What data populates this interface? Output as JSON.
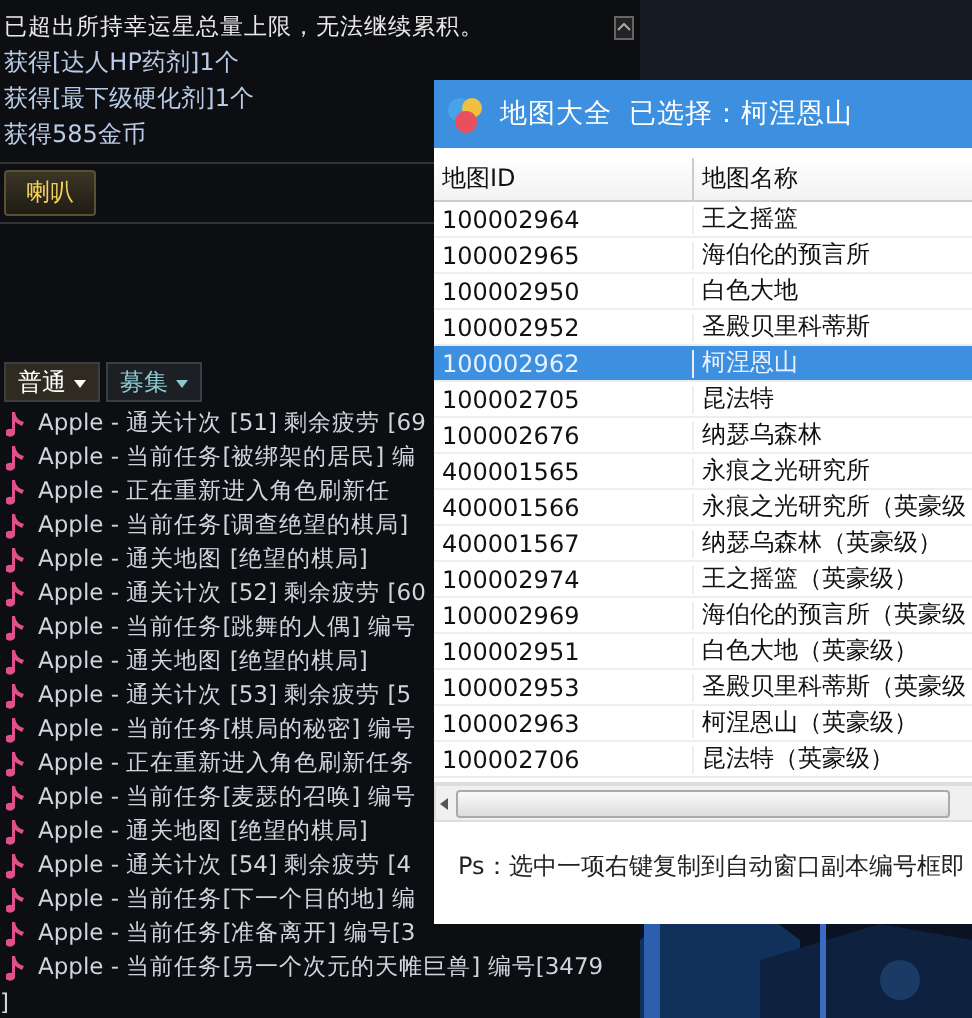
{
  "system_messages": [
    {
      "text": "已超出所持幸运星总量上限，无法继续累积。",
      "kind": "notice"
    },
    {
      "text": "获得[达人HP药剂]1个",
      "kind": "loot"
    },
    {
      "text": "获得[最下级硬化剂]1个",
      "kind": "loot"
    },
    {
      "text": "获得585金币",
      "kind": "loot"
    }
  ],
  "horn_button": "喇叭",
  "chat_tabs": [
    {
      "label": "普通",
      "selected": true
    },
    {
      "label": "募集",
      "selected": false
    }
  ],
  "chat_lines": [
    {
      "text": "Apple - 通关计次 [51] 剩余疲劳 [69"
    },
    {
      "text": "Apple - 当前任务[被绑架的居民] 编"
    },
    {
      "text": "Apple - 正在重新进入角色刷新任"
    },
    {
      "text": "Apple - 当前任务[调查绝望的棋局]"
    },
    {
      "text": "Apple - 通关地图 [绝望的棋局]"
    },
    {
      "text": "Apple - 通关计次 [52] 剩余疲劳 [60"
    },
    {
      "text": "Apple - 当前任务[跳舞的人偶] 编号"
    },
    {
      "text": "Apple - 通关地图 [绝望的棋局]"
    },
    {
      "text": "Apple - 通关计次 [53] 剩余疲劳 [5"
    },
    {
      "text": "Apple - 当前任务[棋局的秘密] 编号"
    },
    {
      "text": "Apple - 正在重新进入角色刷新任务"
    },
    {
      "text": "Apple - 当前任务[麦瑟的召唤] 编号"
    },
    {
      "text": "Apple - 通关地图 [绝望的棋局]"
    },
    {
      "text": "Apple - 通关计次 [54] 剩余疲劳 [4"
    },
    {
      "text": "Apple - 当前任务[下一个目的地] 编"
    },
    {
      "text": "Apple - 当前任务[准备离开] 编号[3"
    },
    {
      "text": "Apple - 当前任务[另一个次元的天帷巨兽] 编号[3479"
    }
  ],
  "chat_tail": "]",
  "dialog": {
    "title": "地图大全  已选择：柯涅恩山",
    "columns": [
      "地图ID",
      "地图名称"
    ],
    "rows": [
      {
        "id": "100002964",
        "name": "王之摇篮",
        "selected": false
      },
      {
        "id": "100002965",
        "name": "海伯伦的预言所",
        "selected": false
      },
      {
        "id": "100002950",
        "name": "白色大地",
        "selected": false
      },
      {
        "id": "100002952",
        "name": "圣殿贝里科蒂斯",
        "selected": false
      },
      {
        "id": "100002962",
        "name": "柯涅恩山",
        "selected": true
      },
      {
        "id": "100002705",
        "name": "昆法特",
        "selected": false
      },
      {
        "id": "100002676",
        "name": "纳瑟乌森林",
        "selected": false
      },
      {
        "id": "400001565",
        "name": "永痕之光研究所",
        "selected": false
      },
      {
        "id": "400001566",
        "name": "永痕之光研究所（英豪级",
        "selected": false
      },
      {
        "id": "400001567",
        "name": "纳瑟乌森林（英豪级）",
        "selected": false
      },
      {
        "id": "100002974",
        "name": "王之摇篮（英豪级）",
        "selected": false
      },
      {
        "id": "100002969",
        "name": "海伯伦的预言所（英豪级",
        "selected": false
      },
      {
        "id": "100002951",
        "name": "白色大地（英豪级）",
        "selected": false
      },
      {
        "id": "100002953",
        "name": "圣殿贝里科蒂斯（英豪级",
        "selected": false
      },
      {
        "id": "100002963",
        "name": "柯涅恩山（英豪级）",
        "selected": false
      },
      {
        "id": "100002706",
        "name": "昆法特（英豪级）",
        "selected": false
      }
    ],
    "footer": "Ps：选中一项右键复制到自动窗口副本编号框即"
  }
}
